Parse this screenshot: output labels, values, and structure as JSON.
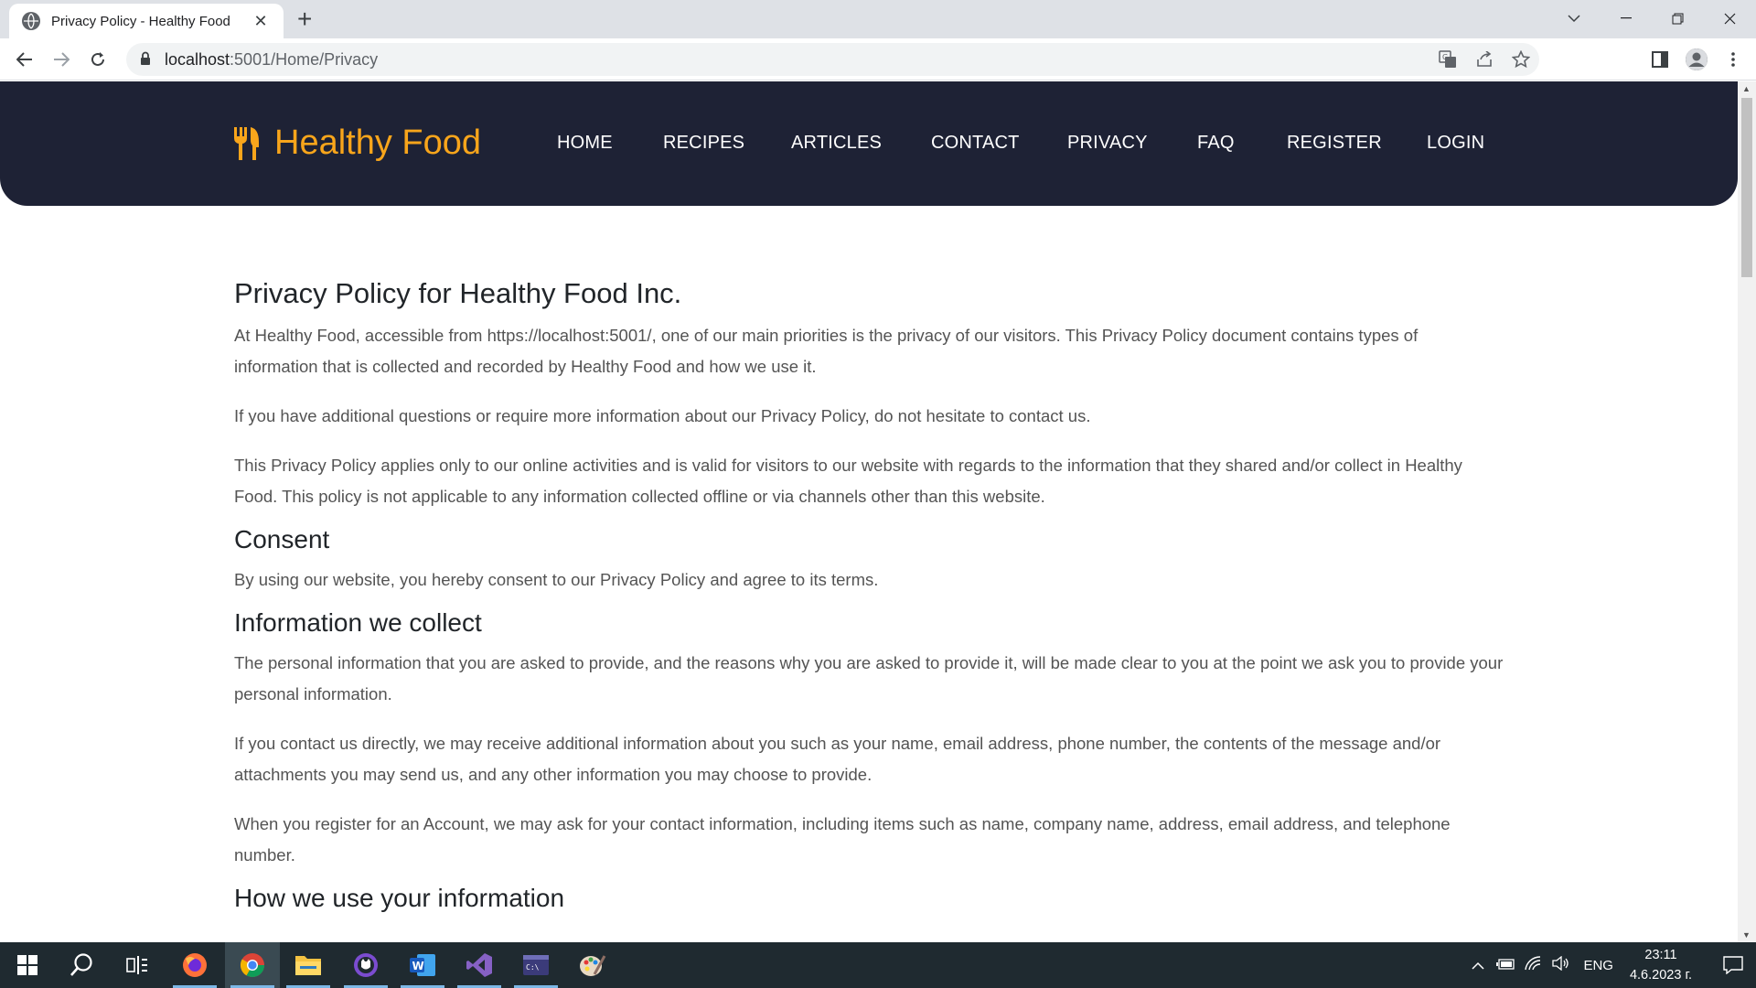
{
  "browser": {
    "tab_title": "Privacy Policy - Healthy Food",
    "url_host": "localhost",
    "url_path": ":5001/Home/Privacy"
  },
  "site": {
    "logo_text": "Healthy Food",
    "nav": [
      "HOME",
      "RECIPES",
      "ARTICLES",
      "CONTACT",
      "PRIVACY",
      "FAQ",
      "REGISTER",
      "LOGIN"
    ]
  },
  "content": {
    "title": "Privacy Policy for Healthy Food Inc.",
    "intro_1": "At Healthy Food, accessible from https://localhost:5001/, one of our main priorities is the privacy of our visitors. This Privacy Policy document contains types of information that is collected and recorded by Healthy Food and how we use it.",
    "intro_2": "If you have additional questions or require more information about our Privacy Policy, do not hesitate to contact us.",
    "intro_3": "This Privacy Policy applies only to our online activities and is valid for visitors to our website with regards to the information that they shared and/or collect in Healthy Food. This policy is not applicable to any information collected offline or via channels other than this website.",
    "consent_heading": "Consent",
    "consent_text": "By using our website, you hereby consent to our Privacy Policy and agree to its terms.",
    "collect_heading": "Information we collect",
    "collect_1": "The personal information that you are asked to provide, and the reasons why you are asked to provide it, will be made clear to you at the point we ask you to provide your personal information.",
    "collect_2": "If you contact us directly, we may receive additional information about you such as your name, email address, phone number, the contents of the message and/or attachments you may send us, and any other information you may choose to provide.",
    "collect_3": "When you register for an Account, we may ask for your contact information, including items such as name, company name, address, email address, and telephone number.",
    "use_heading": "How we use your information"
  },
  "taskbar": {
    "language": "ENG",
    "time": "23:11",
    "date": "4.6.2023 г."
  },
  "colors": {
    "header_bg": "#1e2235",
    "logo": "#f8a51b",
    "taskbar": "#1f2a30"
  }
}
